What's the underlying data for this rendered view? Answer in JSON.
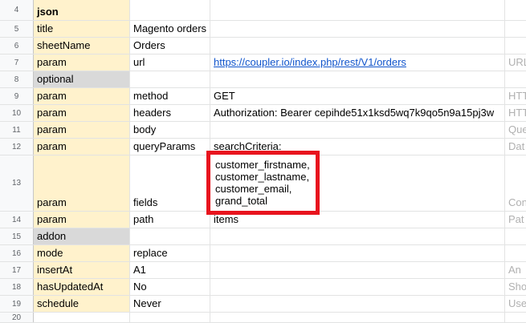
{
  "rows": [
    {
      "num": "4",
      "a": "json",
      "b": "",
      "c": "",
      "d": ""
    },
    {
      "num": "5",
      "a": "title",
      "b": "Magento orders",
      "c": "",
      "d": ""
    },
    {
      "num": "6",
      "a": "sheetName",
      "b": "Orders",
      "c": "",
      "d": ""
    },
    {
      "num": "7",
      "a": "param",
      "b": "url",
      "c": "https://coupler.io/index.php/rest/V1/orders",
      "d": "URL"
    },
    {
      "num": "8",
      "a": "optional",
      "b": "",
      "c": "",
      "d": ""
    },
    {
      "num": "9",
      "a": "param",
      "b": "method",
      "c": "GET",
      "d": "HTT"
    },
    {
      "num": "10",
      "a": "param",
      "b": "headers",
      "c": "Authorization: Bearer cepihde51x1ksd5wq7k9qo5n9a15pj3w",
      "d": "HTT"
    },
    {
      "num": "11",
      "a": "param",
      "b": "body",
      "c": "",
      "d": "Que"
    },
    {
      "num": "12",
      "a": "param",
      "b": "queryParams",
      "c": "searchCriteria:",
      "d": "Dat"
    },
    {
      "num": "13",
      "a": "param",
      "b": "fields",
      "c": "",
      "d": "Con"
    },
    {
      "num": "14",
      "a": "param",
      "b": "path",
      "c": "items",
      "d": "Pat"
    },
    {
      "num": "15",
      "a": "addon",
      "b": "",
      "c": "",
      "d": ""
    },
    {
      "num": "16",
      "a": "mode",
      "b": "replace",
      "c": "",
      "d": ""
    },
    {
      "num": "17",
      "a": "insertAt",
      "b": "A1",
      "c": "",
      "d": "An"
    },
    {
      "num": "18",
      "a": "hasUpdatedAt",
      "b": "No",
      "c": "",
      "d": "Sho"
    },
    {
      "num": "19",
      "a": "schedule",
      "b": "Never",
      "c": "",
      "d": "Use"
    },
    {
      "num": "20",
      "a": "",
      "b": "",
      "c": "",
      "d": ""
    }
  ],
  "fields_box": {
    "line1": "customer_firstname,",
    "line2": "customer_lastname,",
    "line3": "customer_email,",
    "line4": "grand_total"
  },
  "colors": {
    "highlight": "#fff2cc",
    "section": "#d9d9d9",
    "box_border": "#e8141e",
    "link": "#1155cc"
  }
}
